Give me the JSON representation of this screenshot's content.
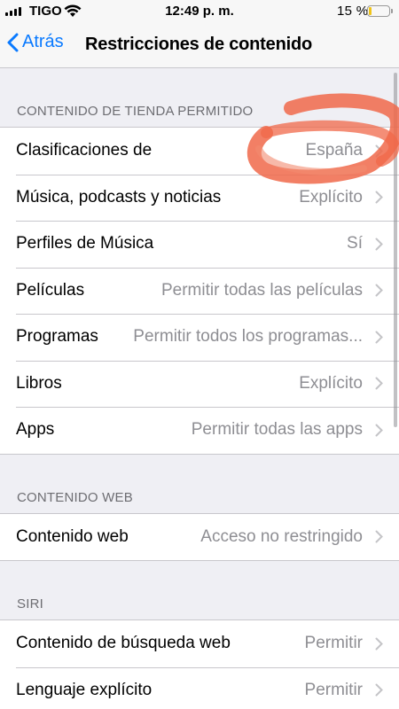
{
  "status_bar": {
    "carrier": "TIGO",
    "time": "12:49 p. m.",
    "battery_percent": "15 %"
  },
  "nav": {
    "back_label": "Atrás",
    "title": "Restricciones de contenido"
  },
  "sections": {
    "store": {
      "header": "CONTENIDO DE TIENDA PERMITIDO",
      "rows": [
        {
          "label": "Clasificaciones de",
          "value": "España"
        },
        {
          "label": "Música, podcasts y noticias",
          "value": "Explícito"
        },
        {
          "label": "Perfiles de Música",
          "value": "Sí"
        },
        {
          "label": "Películas",
          "value": "Permitir todas las películas"
        },
        {
          "label": "Programas",
          "value": "Permitir todos los programas..."
        },
        {
          "label": "Libros",
          "value": "Explícito"
        },
        {
          "label": "Apps",
          "value": "Permitir todas las apps"
        }
      ]
    },
    "web": {
      "header": "CONTENIDO WEB",
      "rows": [
        {
          "label": "Contenido web",
          "value": "Acceso no restringido"
        }
      ]
    },
    "siri": {
      "header": "SIRI",
      "rows": [
        {
          "label": "Contenido de búsqueda web",
          "value": "Permitir"
        },
        {
          "label": "Lenguaje explícito",
          "value": "Permitir"
        }
      ]
    }
  },
  "colors": {
    "accent": "#0a7aff",
    "annotation": "#f0684a",
    "battery_low": "#f0c419"
  },
  "icons": [
    "signal-icon",
    "wifi-icon",
    "battery-icon",
    "back-chevron-icon",
    "chevron-right-icon"
  ]
}
